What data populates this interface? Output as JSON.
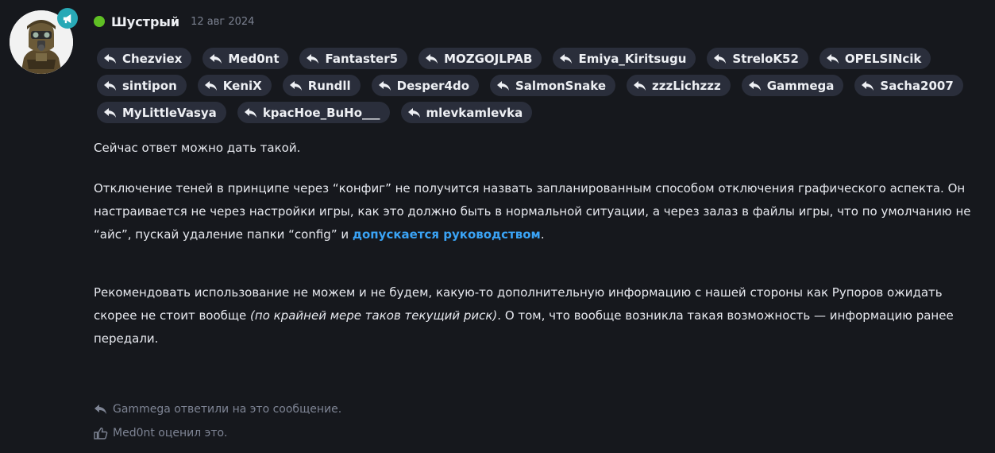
{
  "author": {
    "name": "Шустрый",
    "date": "12 авг 2024",
    "avatar_icon": "soldier-gasmask-avatar",
    "badge_icon": "megaphone-icon",
    "online_color": "#5fbf24"
  },
  "reply_tags": [
    "Chezviex",
    "Med0nt",
    "Fantaster5",
    "MOZGOJLPAB",
    "Emiya_Kiritsugu",
    "StreloK52",
    "OPELSINcik",
    "sintipon",
    "KeniX",
    "Rundll",
    "Desper4do",
    "SalmonSnake",
    "zzzLichzzz",
    "Gammega",
    "Sacha2007",
    "MyLittleVasya",
    "kpacHoe_BuHo___",
    "mlevkamlevka"
  ],
  "message": {
    "p1": "Сейчас ответ можно дать такой.",
    "p2_text": "Отключение теней в принципе через “конфиг” не получится назвать запланированным способом отключения графического аспекта. Он настраивается не через настройки игры, как это должно быть в нормальной ситуации, а через залаз в файлы игры, что по умолчанию не “айс”, пускай удаление папки “config” и ",
    "p2_link": "допускается руководством",
    "p2_end": ".",
    "p3_a": "Рекомендовать использование не можем и не будем, какую-то дополнительную информацию с нашей стороны как Рупоров ожидать скорее не стоит вообще ",
    "p3_italic": "(по крайней мере таков текущий риск)",
    "p3_b": ". О том, что вообще возникла такая возможность — информацию ранее передали."
  },
  "footer": {
    "replied": "Gammega ответили на это сообщение.",
    "liked": "Med0nt оценил это."
  },
  "colors": {
    "background": "#16181d",
    "tag_bg": "#2a2e3b",
    "link": "#3aa3f5",
    "badge": "#28a9b6"
  }
}
